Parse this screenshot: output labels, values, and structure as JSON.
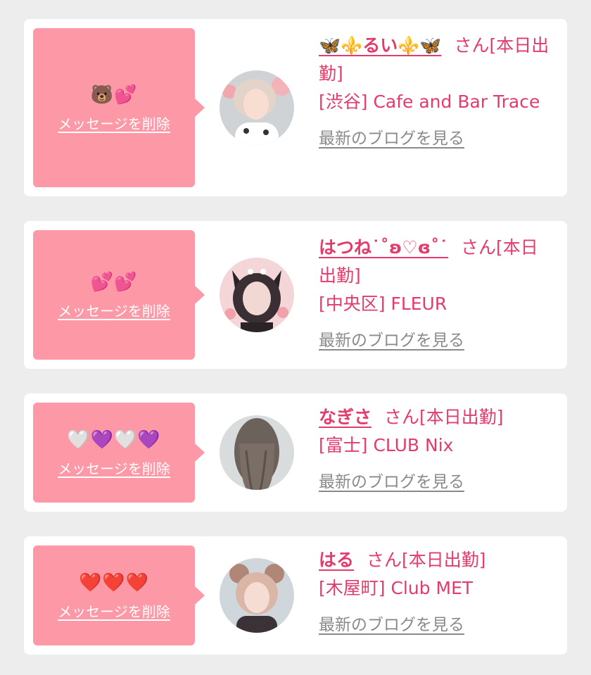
{
  "items": [
    {
      "message": "🐻💕",
      "delete_label": "メッセージを削除",
      "name": "🦋⚜️るい⚜️🦋",
      "san": "さん",
      "status": "[本日出勤]",
      "shop": "[渋谷] Cafe and Bar Trace",
      "blog_label": "最新のブログを見る",
      "avatar_icon": "avatar-photo"
    },
    {
      "message": "💕💕",
      "delete_label": "メッセージを削除",
      "name": "はつね˙˚ʚ♡ɞ˚˙",
      "san": "さん",
      "status": "[本日出勤]",
      "shop": "[中央区] FLEUR",
      "blog_label": "最新のブログを見る",
      "avatar_icon": "avatar-photo"
    },
    {
      "message": "🤍💜🤍💜",
      "delete_label": "メッセージを削除",
      "name": "なぎさ",
      "san": "さん",
      "status": "[本日出勤]",
      "shop": "[富士] CLUB Nix",
      "blog_label": "最新のブログを見る",
      "avatar_icon": "avatar-photo"
    },
    {
      "message": "❤️❤️❤️",
      "delete_label": "メッセージを削除",
      "name": "はる",
      "san": "さん",
      "status": "[本日出勤]",
      "shop": "[木屋町] Club MET",
      "blog_label": "最新のブログを見る",
      "avatar_icon": "avatar-photo"
    }
  ],
  "colors": {
    "background": "#ededee",
    "bubble": "#fd98a6",
    "accent": "#e33b6c",
    "link_gray": "#8a8a8a"
  }
}
